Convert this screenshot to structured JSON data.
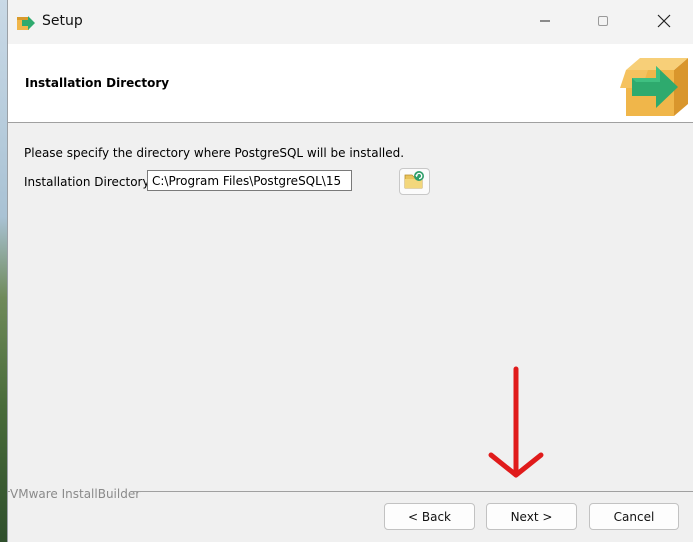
{
  "window": {
    "title": "Setup",
    "controls": {
      "minimize": "minimize-icon",
      "maximize": "maximize-icon",
      "close": "close-icon"
    }
  },
  "header": {
    "title": "Installation Directory",
    "logo_icon": "installer-box-arrow-icon"
  },
  "body": {
    "intro_text": "Please specify the directory where PostgreSQL will be installed.",
    "directory_label": "Installation Directory",
    "directory_value": "C:\\Program Files\\PostgreSQL\\15",
    "browse_icon": "folder-browse-icon"
  },
  "annotation": {
    "icon": "red-arrow-down-icon",
    "color": "#e01b1b"
  },
  "footer": {
    "brand": "VMware InstallBuilder",
    "back_label": "< Back",
    "next_label": "Next >",
    "cancel_label": "Cancel"
  },
  "colors": {
    "accent_green": "#2eaa6e",
    "box_orange": "#f0b64a"
  }
}
